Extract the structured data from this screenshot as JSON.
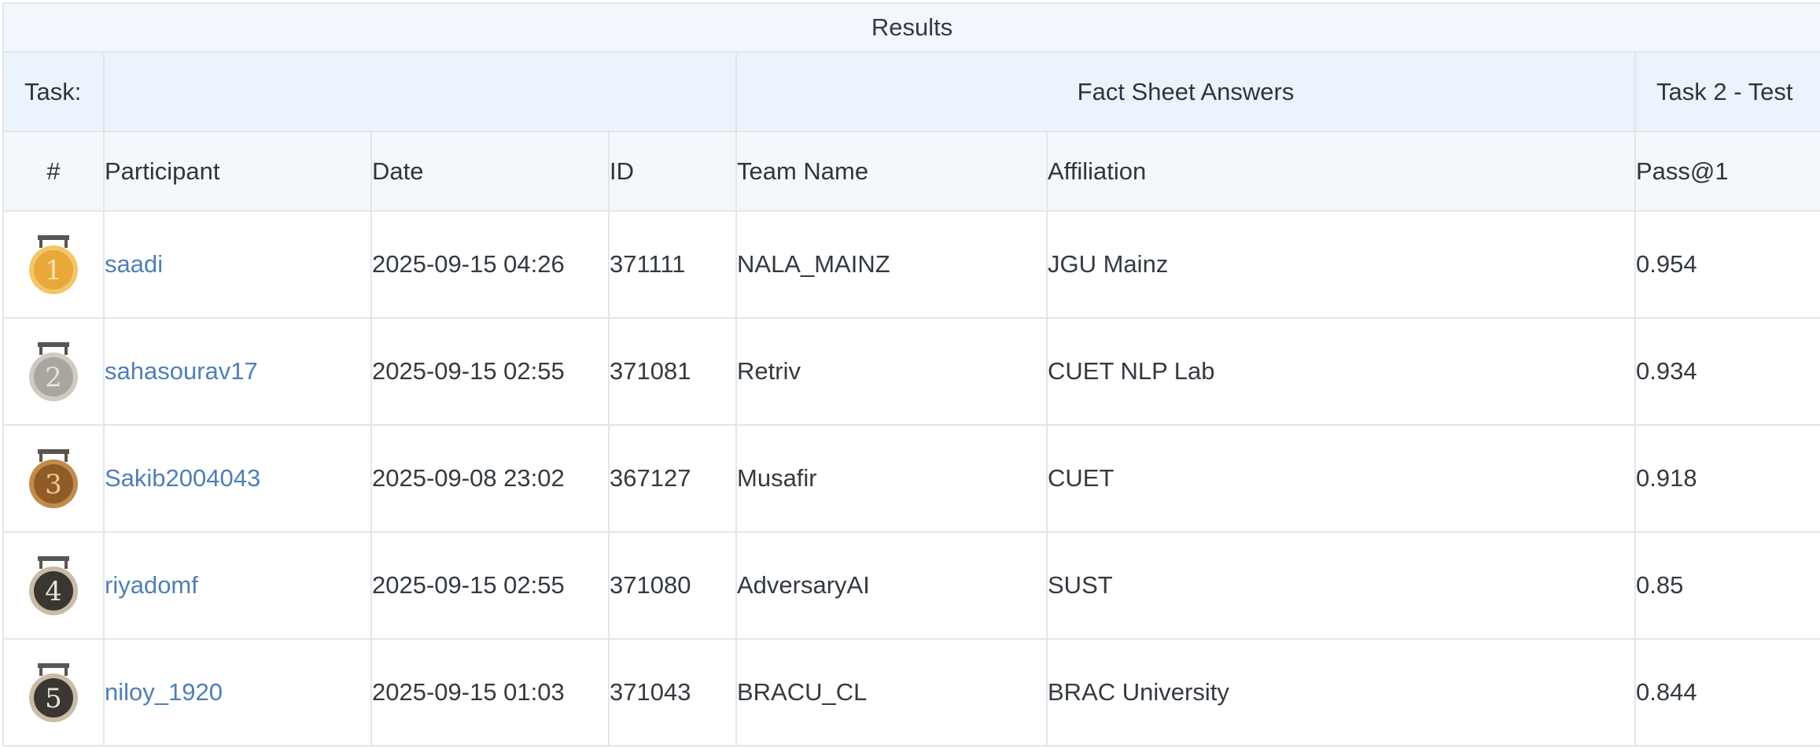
{
  "table": {
    "title": "Results",
    "task_label": "Task:",
    "group_fact_sheet": "Fact Sheet Answers",
    "group_task": "Task 2 - Test",
    "columns": {
      "rank": "#",
      "participant": "Participant",
      "date": "Date",
      "id": "ID",
      "team_name": "Team Name",
      "affiliation": "Affiliation",
      "pass1": "Pass@1"
    },
    "rows": [
      {
        "rank": "1",
        "medal_color": "#e8a93a",
        "medal_edge": "#f3c769",
        "participant": "saadi",
        "date": "2025-09-15 04:26",
        "id": "371111",
        "team_name": "NALA_MAINZ",
        "affiliation": "JGU Mainz",
        "pass1": "0.954"
      },
      {
        "rank": "2",
        "medal_color": "#a9a59f",
        "medal_edge": "#cfcac2",
        "participant": "sahasourav17",
        "date": "2025-09-15 02:55",
        "id": "371081",
        "team_name": "Retriv",
        "affiliation": "CUET NLP Lab",
        "pass1": "0.934"
      },
      {
        "rank": "3",
        "medal_color": "#8f5b27",
        "medal_edge": "#c28a4c",
        "participant": "Sakib2004043",
        "date": "2025-09-08 23:02",
        "id": "367127",
        "team_name": "Musafir",
        "affiliation": "CUET",
        "pass1": "0.918"
      },
      {
        "rank": "4",
        "medal_color": "#3a3632",
        "medal_edge": "#c9bca6",
        "participant": "riyadomf",
        "date": "2025-09-15 02:55",
        "id": "371080",
        "team_name": "AdversaryAI",
        "affiliation": "SUST",
        "pass1": "0.85"
      },
      {
        "rank": "5",
        "medal_color": "#3a3632",
        "medal_edge": "#c9bca6",
        "participant": "niloy_1920",
        "date": "2025-09-15 01:03",
        "id": "371043",
        "team_name": "BRACU_CL",
        "affiliation": "BRAC University",
        "pass1": "0.844"
      }
    ]
  }
}
